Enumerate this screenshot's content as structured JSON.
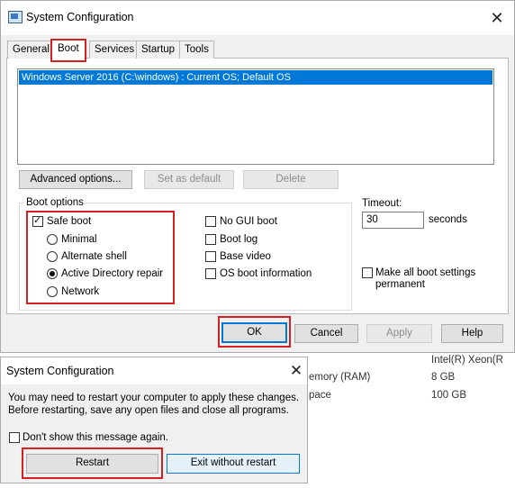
{
  "main_window": {
    "title": "System Configuration",
    "close_glyph": "✕",
    "tabs": [
      {
        "label": "General"
      },
      {
        "label": "Boot"
      },
      {
        "label": "Services"
      },
      {
        "label": "Startup"
      },
      {
        "label": "Tools"
      }
    ],
    "os_list": [
      "Windows Server 2016 (C:\\windows) : Current OS; Default OS"
    ],
    "buttons": {
      "advanced": "Advanced options...",
      "set_default": "Set as default",
      "delete": "Delete",
      "ok": "OK",
      "cancel": "Cancel",
      "apply": "Apply",
      "help": "Help"
    },
    "boot_options": {
      "label": "Boot options",
      "safe_boot": {
        "label": "Safe boot",
        "checked": true
      },
      "radios": [
        {
          "label": "Minimal",
          "checked": false
        },
        {
          "label": "Alternate shell",
          "checked": false
        },
        {
          "label": "Active Directory repair",
          "checked": true
        },
        {
          "label": "Network",
          "checked": false
        }
      ],
      "checks": [
        {
          "label": "No GUI boot",
          "checked": false
        },
        {
          "label": "Boot log",
          "checked": false
        },
        {
          "label": "Base video",
          "checked": false
        },
        {
          "label": "OS boot information",
          "checked": false
        }
      ]
    },
    "timeout": {
      "label": "Timeout:",
      "value": "30",
      "unit": "seconds"
    },
    "permanent": {
      "label_1": "Make all boot settings",
      "label_2": "permanent",
      "checked": false
    }
  },
  "background": {
    "processor": "Intel(R) Xeon(R",
    "memory_label": "emory (RAM)",
    "memory_value": "8 GB",
    "space_label": "pace",
    "space_value": "100 GB"
  },
  "dialog": {
    "title": "System Configuration",
    "close_glyph": "✕",
    "message_1": "You may need to restart your computer to apply these changes.",
    "message_2": "Before restarting, save any open files and close all programs.",
    "dont_show": "Don't show this message again.",
    "restart": "Restart",
    "exit": "Exit without restart"
  },
  "colors": {
    "highlight": "#d42020",
    "selection": "#0078d7"
  }
}
